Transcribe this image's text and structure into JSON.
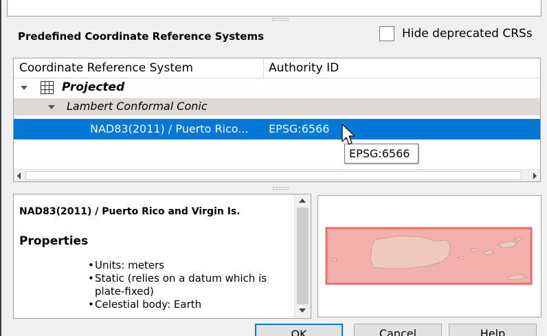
{
  "section_title": "Predefined Coordinate Reference Systems",
  "hide_deprecated": {
    "label": "Hide deprecated CRSs",
    "checked": false
  },
  "tree": {
    "headers": [
      "Coordinate Reference System",
      "Authority ID"
    ],
    "rows": [
      {
        "label": "Projected",
        "level": 0,
        "expanded": true
      },
      {
        "label": "Lambert Conformal Conic",
        "level": 1,
        "expanded": true
      },
      {
        "label": "NAD83(2011) / Puerto Rico...",
        "authority": "EPSG:6566",
        "level": 2,
        "selected": true
      }
    ]
  },
  "tooltip": "EPSG:6566",
  "properties": {
    "title": "NAD83(2011) / Puerto Rico and Virgin Is.",
    "heading": "Properties",
    "items": [
      "Units: meters",
      "Static (relies on a datum which is plate-fixed)",
      "Celestial body: Earth"
    ]
  },
  "buttons": {
    "ok": "OK",
    "cancel": "Cancel",
    "help": "Help"
  },
  "colors": {
    "selection": "#0078d7",
    "extent_fill": "#f4b0aa",
    "extent_border": "#ee6b6b"
  }
}
